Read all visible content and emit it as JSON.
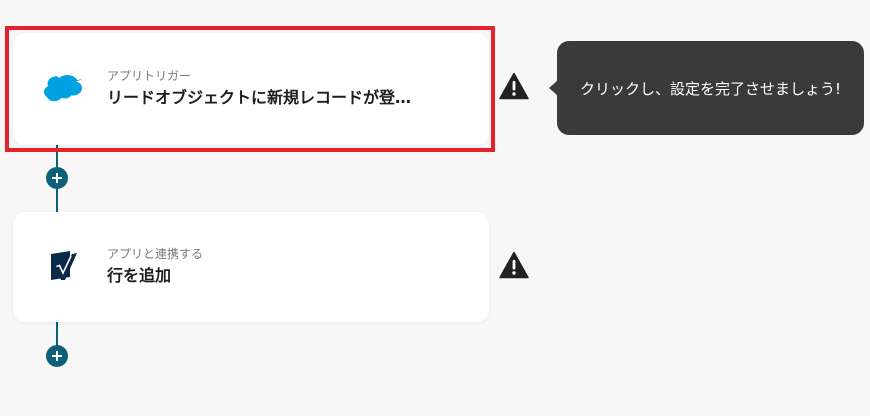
{
  "flow": {
    "steps": [
      {
        "subtitle": "アプリトリガー",
        "title": "リードオブジェクトに新規レコードが登…",
        "icon": "salesforce-cloud-icon"
      },
      {
        "subtitle": "アプリと連携する",
        "title": "行を追加",
        "icon": "smartsheet-icon"
      }
    ],
    "warning_icon": "warning-icon",
    "add_icon": "plus-icon"
  },
  "tooltip": {
    "text": "クリックし、設定を完了させましょう!"
  },
  "colors": {
    "accent": "#0e5f7a",
    "highlight": "#e5222c",
    "salesforce": "#00a1e0",
    "smartsheet": "#0b2a4a",
    "tooltip_bg": "#3a3a3a"
  }
}
